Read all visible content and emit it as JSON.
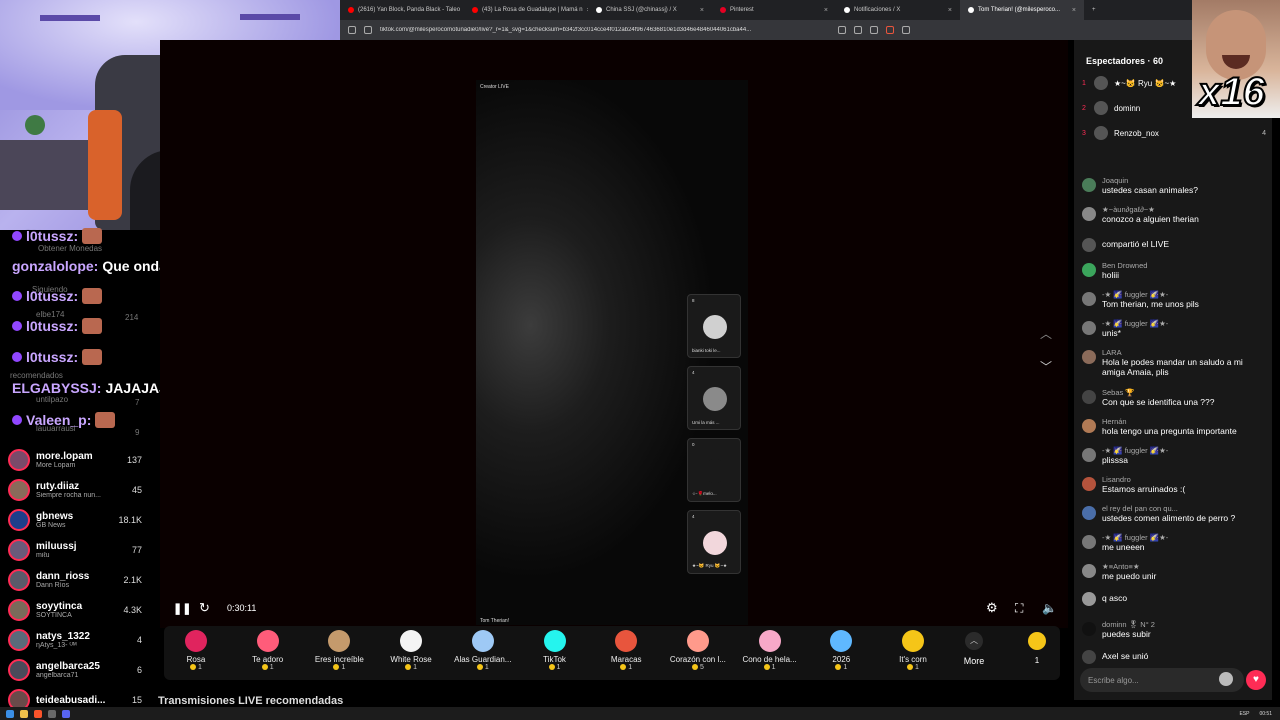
{
  "browser": {
    "tabs": [
      {
        "title": "(2616) Yan Block, Panda Black - Taleo",
        "color": "#ff0000"
      },
      {
        "title": "(43) La Rosa de Guadalupe | Mamá n",
        "color": "#ff0000"
      },
      {
        "title": "China SSJ (@chinassj) / X",
        "color": "#ffffff"
      },
      {
        "title": "Pinterest",
        "color": "#e60023"
      },
      {
        "title": "Notificaciones / X",
        "color": "#ffffff"
      },
      {
        "title": "Tom Therian! (@milesperoco...",
        "color": "#ffffff",
        "active": true
      }
    ],
    "url": "tiktok.com/@milesperocomotunadie0/live?_r=1&_svg=1&checksum=b342f3cc014cce4f012ab24f9674636810e1d3d46e4846044061cba44..."
  },
  "stream_chat": {
    "lines": [
      {
        "user": "l0tussz:",
        "msg": "",
        "emote": true
      },
      {
        "user": "gonzalolope:",
        "msg": "Que onda",
        "emote": false
      },
      {
        "user": "l0tussz:",
        "msg": "",
        "emote": true
      },
      {
        "user": "l0tussz:",
        "msg": "",
        "emote": true
      },
      {
        "user": "l0tussz:",
        "msg": "",
        "emote": true
      },
      {
        "user": "ELGABYSSJ:",
        "msg": "JAJAJAJAJ",
        "emote": false
      },
      {
        "user": "Valeen_p:",
        "msg": "",
        "emote": true
      }
    ],
    "ghost_text": [
      "Obtener Monedas",
      "Siguiendo",
      "elbe174",
      "214",
      "recomendados",
      "untilpazo",
      "7",
      "lauuarrausi",
      "9"
    ]
  },
  "left_sidebar": {
    "items": [
      {
        "name": "more.lopam",
        "sub": "More Lopam",
        "count": "137"
      },
      {
        "name": "ruty.diiaz",
        "sub": "Siempre rocha nun...",
        "count": "45"
      },
      {
        "name": "gbnews",
        "sub": "GB News",
        "count": "18.1K",
        "verified": true
      },
      {
        "name": "miluussj",
        "sub": "miℓu",
        "count": "77"
      },
      {
        "name": "dann_rioss",
        "sub": "Dann Ríos",
        "count": "2.1K"
      },
      {
        "name": "soyytinca",
        "sub": "SOYTINCA",
        "count": "4.3K"
      },
      {
        "name": "natys_1322",
        "sub": "ηAtys_13- ᴼᴹ",
        "count": "4"
      },
      {
        "name": "angelbarca25",
        "sub": "angelbarca71",
        "count": "6"
      },
      {
        "name": "teideabusadi...",
        "sub": "",
        "count": "15"
      }
    ]
  },
  "stream": {
    "creator_label": "Creator LIVE",
    "host_label": "Tom Therian!",
    "guests": [
      {
        "name": "bianki toki le...",
        "count": "8",
        "color": "#d0d0d0"
      },
      {
        "name": "Umi la más ...",
        "count": "4",
        "color": "#8a8a8a"
      },
      {
        "name": "☆-🌹melo...",
        "count": "0",
        "color": "#1a1a1a"
      },
      {
        "name": "★~😺 Ryu 😺~★",
        "count": "4",
        "color": "#f2d7dc"
      }
    ]
  },
  "player": {
    "time": "0:30:11"
  },
  "gifts": {
    "items": [
      {
        "name": "Rosa",
        "cost": "1",
        "color": "#e0245e"
      },
      {
        "name": "Te adoro",
        "cost": "1",
        "color": "#ff5c7a"
      },
      {
        "name": "Eres increíble",
        "cost": "1",
        "color": "#c49a6c"
      },
      {
        "name": "White Rose",
        "cost": "1",
        "color": "#f4f4f4"
      },
      {
        "name": "Alas Guardian...",
        "cost": "1",
        "color": "#9ec9f5"
      },
      {
        "name": "TikTok",
        "cost": "1",
        "color": "#25f4ee"
      },
      {
        "name": "Maracas",
        "cost": "1",
        "color": "#e8553d"
      },
      {
        "name": "Corazón con l...",
        "cost": "5",
        "color": "#ff9a8b"
      },
      {
        "name": "Cono de hela...",
        "cost": "1",
        "color": "#f7a8c8"
      },
      {
        "name": "2026",
        "cost": "1",
        "color": "#5fb8ff"
      },
      {
        "name": "It's corn",
        "cost": "1",
        "color": "#f5c518"
      }
    ],
    "more_label": "More",
    "wallet_label": "1"
  },
  "recommended_heading": "Transmisiones LIVE recomendadas",
  "right_panel": {
    "viewers_title": "Espectadores · 60",
    "top_viewers": [
      {
        "rank": "1",
        "name": "★~😺 Ryu 😺~★",
        "score": ""
      },
      {
        "rank": "2",
        "name": "dominn",
        "score": ""
      },
      {
        "rank": "3",
        "name": "Renzob_nox",
        "score": "4"
      }
    ],
    "chat": [
      {
        "name": "Joaquin",
        "text": "ustedes casan animales?",
        "color": "#4a7c59"
      },
      {
        "name": "★~àun∂gaℓ∂~★",
        "text": "conozco a alguien therian",
        "color": "#888"
      },
      {
        "name": "",
        "text": "compartió el LIVE",
        "color": "#555"
      },
      {
        "name": "Ben Drowned",
        "text": "holiii",
        "color": "#3ba55c"
      },
      {
        "name": "-★ 🌠 fuggler 🌠★-",
        "text": "Tom therian, me unos pils",
        "color": "#777"
      },
      {
        "name": "-★ 🌠 fuggler 🌠★-",
        "text": "unis*",
        "color": "#777"
      },
      {
        "name": "LARA",
        "text": "Hola le podes mandar un saludo a mi amiga Amaia, plis",
        "color": "#8b6b5a"
      },
      {
        "name": "Sebas 🏆",
        "text": "Con que se identifica una ???",
        "color": "#444"
      },
      {
        "name": "Hernán",
        "text": "hola tengo una pregunta importante",
        "color": "#b07a55"
      },
      {
        "name": "-★ 🌠 fuggler 🌠★-",
        "text": "plisssa",
        "color": "#777"
      },
      {
        "name": "Lisandro",
        "text": "Estamos arruinados :(",
        "color": "#b5533c"
      },
      {
        "name": "el rey del pan con qu...",
        "text": "ustedes comen alimento de perro ?",
        "color": "#4a6ea9"
      },
      {
        "name": "-★ 🌠 fuggler 🌠★-",
        "text": "me uneeen",
        "color": "#777"
      },
      {
        "name": "★≡Anto≡★",
        "text": "me puedo unir",
        "color": "#888"
      },
      {
        "name": "",
        "text": "q asco",
        "color": "#999"
      },
      {
        "name": "dominn 🎖 N° 2",
        "text": "puedes subir",
        "color": "#111"
      },
      {
        "name": "",
        "text": "Axel  se unió",
        "color": "#444"
      }
    ],
    "input_placeholder": "Escribe algo..."
  },
  "meme": {
    "text": "x16"
  },
  "taskbar": {
    "lang": "ESP",
    "time": "00:51"
  }
}
